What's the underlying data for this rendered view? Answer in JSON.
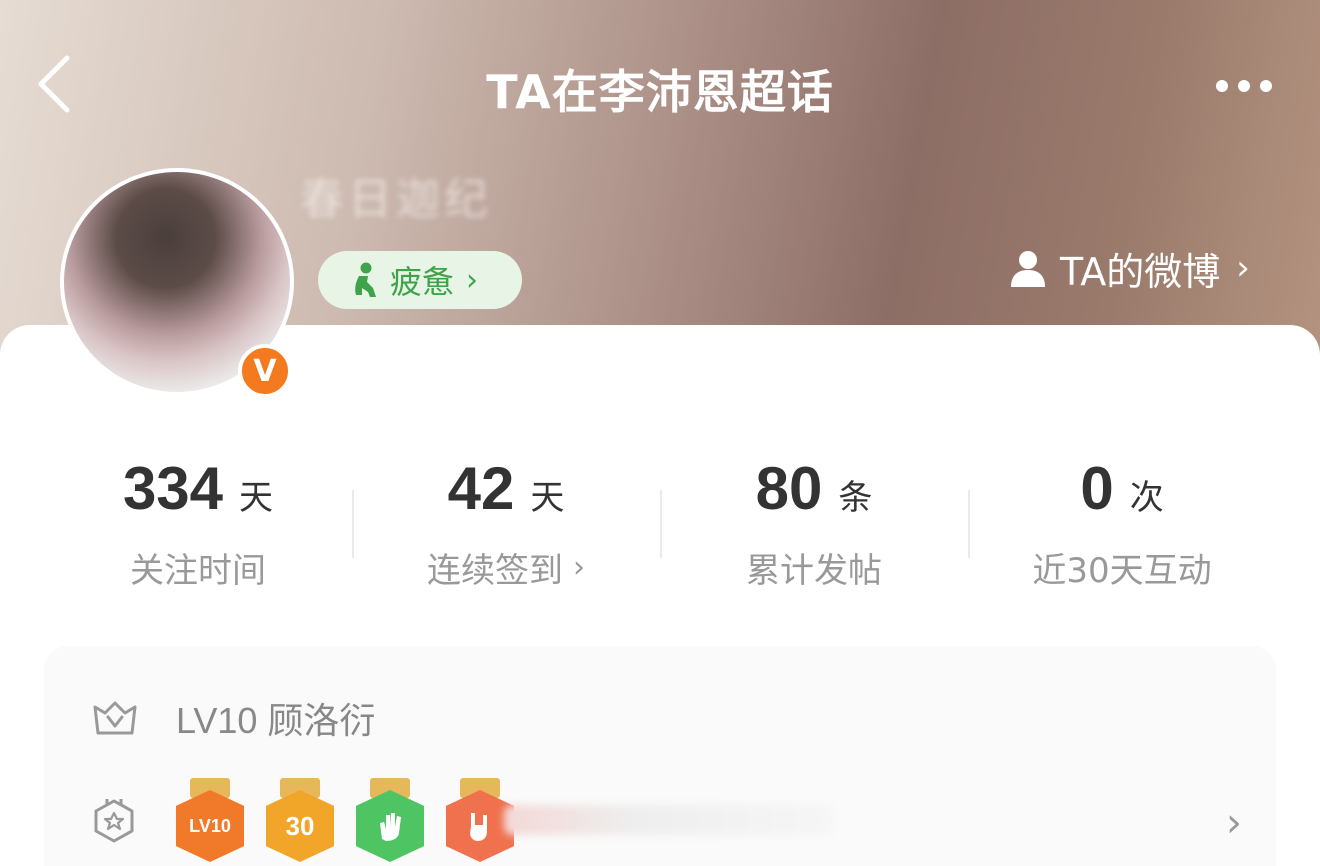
{
  "header": {
    "title": "TA在李沛恩超话",
    "back_icon": "chevron-left-icon",
    "more_icon": "more-dots-icon"
  },
  "profile": {
    "username": "春日迦纪",
    "verified_mark": "V",
    "mood": {
      "label": "疲惫",
      "arrow": "›"
    },
    "weibo_link": {
      "label": "TA的微博",
      "arrow": "›"
    }
  },
  "stats": [
    {
      "value": "334",
      "unit": "天",
      "label": "关注时间",
      "has_arrow": false
    },
    {
      "value": "42",
      "unit": "天",
      "label": "连续签到",
      "has_arrow": true
    },
    {
      "value": "80",
      "unit": "条",
      "label": "累计发帖",
      "has_arrow": false
    },
    {
      "value": "0",
      "unit": "次",
      "label": "近30天互动",
      "has_arrow": false
    }
  ],
  "stat_arrow": "›",
  "level": {
    "text": "LV10 顾洛衍"
  },
  "badges": {
    "items": [
      {
        "name": "lv10-medal",
        "text": "LV10",
        "color": "#f07a2a",
        "ribbon": "#e7b85a"
      },
      {
        "name": "30-days-medal",
        "text": "30",
        "color": "#f2a629",
        "ribbon": "#e7b85a"
      },
      {
        "name": "hand-wave-medal",
        "text": "",
        "color": "#4ec462",
        "ribbon": "#e7b85a"
      },
      {
        "name": "rock-hand-medal",
        "text": "",
        "color": "#f0714e",
        "ribbon": "#e7b85a"
      }
    ],
    "arrow": "›"
  },
  "colors": {
    "accent_green": "#3fa34b",
    "verify_orange": "#f47a1f"
  }
}
